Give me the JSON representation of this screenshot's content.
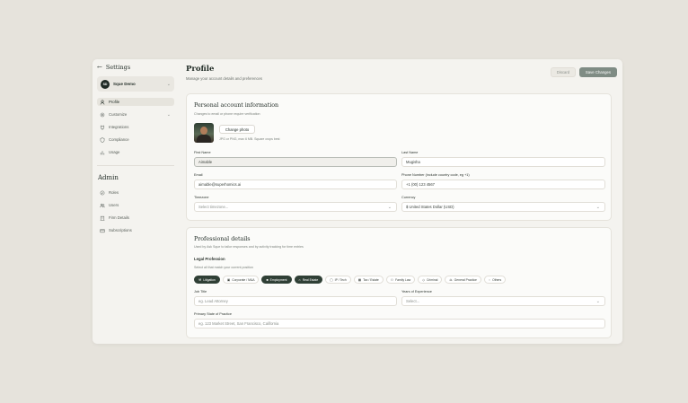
{
  "sidebar": {
    "back_label": "Settings",
    "workspace": {
      "initials": "SD",
      "name": "Sque Demo"
    },
    "items": [
      {
        "label": "Profile"
      },
      {
        "label": "Customize"
      },
      {
        "label": "Integrations"
      },
      {
        "label": "Compliance"
      },
      {
        "label": "Usage"
      }
    ],
    "admin_title": "Admin",
    "admin_items": [
      {
        "label": "Roles"
      },
      {
        "label": "Users"
      },
      {
        "label": "Firm Details"
      },
      {
        "label": "Subscriptions"
      }
    ]
  },
  "header": {
    "title": "Profile",
    "subtitle": "Manage your account details and preferences",
    "discard_label": "Discard",
    "save_label": "Save Changes"
  },
  "personal": {
    "title": "Personal account information",
    "subtitle": "Changes to email or phone require verification",
    "change_photo_label": "Change photo",
    "photo_hint": "JPG or PNG, max 6 MB. Square crops best",
    "first_name_label": "First Name",
    "first_name_value": "Aimable",
    "last_name_label": "Last Name",
    "last_name_value": "Mugisha",
    "email_label": "Email",
    "email_value": "aimable@superhomics.ai",
    "phone_label": "Phone Number (include country code, eg +1)",
    "phone_value": "+1 (00) 123 4567",
    "timezone_label": "Timezone",
    "timezone_value": "Select timezone...",
    "currency_label": "Currency",
    "currency_value": "$ United States Dollar (USD)"
  },
  "professional": {
    "title": "Professional details",
    "subtitle": "Used by Ask Sque to tailor responses and by activity tracking for time entries",
    "legal_label": "Legal Profession",
    "legal_sub": "Select all that match your current position",
    "chips": [
      {
        "label": "Litigation",
        "selected": true,
        "icon": "gavel-icon"
      },
      {
        "label": "Corporate / M&A",
        "selected": false,
        "icon": "building-icon"
      },
      {
        "label": "Employment",
        "selected": true,
        "icon": "briefcase-icon"
      },
      {
        "label": "Real Estate",
        "selected": true,
        "icon": "home-icon"
      },
      {
        "label": "IP / Tech",
        "selected": false,
        "icon": "chip-icon"
      },
      {
        "label": "Tax / Estate",
        "selected": false,
        "icon": "calculator-icon"
      },
      {
        "label": "Family Law",
        "selected": false,
        "icon": "people-icon"
      },
      {
        "label": "Criminal",
        "selected": false,
        "icon": "shield-icon"
      },
      {
        "label": "General Practice",
        "selected": false,
        "icon": "scale-icon"
      },
      {
        "label": "Others",
        "selected": false,
        "icon": "tag-icon"
      }
    ],
    "job_title_label": "Job Title",
    "job_title_placeholder": "eg. Lead Attorney",
    "experience_label": "Years of Experience",
    "experience_value": "Select...",
    "state_label": "Primary State of Practice",
    "state_placeholder": "eg. 123 Market Street, San Francisco, California"
  },
  "colors": {
    "accent": "#2f3f35",
    "save_button": "#7f8c84",
    "background": "#e6e3dc",
    "panel": "#f4f3ef"
  }
}
